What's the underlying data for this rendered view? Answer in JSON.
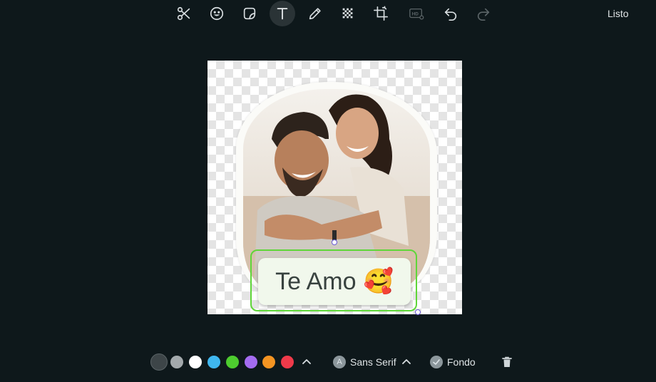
{
  "toolbar": {
    "tools": [
      {
        "name": "scissors-icon",
        "label": "Recortar",
        "active": false
      },
      {
        "name": "emoji-icon",
        "label": "Emoji",
        "active": false
      },
      {
        "name": "sticker-icon",
        "label": "Sticker",
        "active": false
      },
      {
        "name": "text-icon",
        "label": "Texto",
        "active": true
      },
      {
        "name": "pencil-icon",
        "label": "Dibujar",
        "active": false
      },
      {
        "name": "blur-icon",
        "label": "Desenfocar",
        "active": false
      },
      {
        "name": "crop-icon",
        "label": "Recortar imagen",
        "active": false
      },
      {
        "name": "hd-icon",
        "label": "HD",
        "active": false
      },
      {
        "name": "undo-icon",
        "label": "Deshacer",
        "active": false
      },
      {
        "name": "redo-icon",
        "label": "Rehacer",
        "active": false
      }
    ],
    "done_label": "Listo"
  },
  "canvas": {
    "text_sticker": {
      "text": "Te Amo",
      "emoji": "🥰"
    }
  },
  "bottombar": {
    "colors": [
      {
        "name": "dark-gray",
        "hex": "#3d4548",
        "selected": true
      },
      {
        "name": "gray",
        "hex": "#a3a9ac",
        "selected": false
      },
      {
        "name": "white",
        "hex": "#ffffff",
        "selected": false
      },
      {
        "name": "blue",
        "hex": "#3fb7ef",
        "selected": false
      },
      {
        "name": "green",
        "hex": "#4dcc2f",
        "selected": false
      },
      {
        "name": "purple",
        "hex": "#a46cf0",
        "selected": false
      },
      {
        "name": "orange",
        "hex": "#f49422",
        "selected": false
      },
      {
        "name": "red",
        "hex": "#ef3a4a",
        "selected": false
      }
    ],
    "font_badge": "A",
    "font_label": "Sans Serif",
    "background_label": "Fondo"
  },
  "accent": {
    "selection": "#5fd639",
    "handle": "#6b59d8"
  }
}
